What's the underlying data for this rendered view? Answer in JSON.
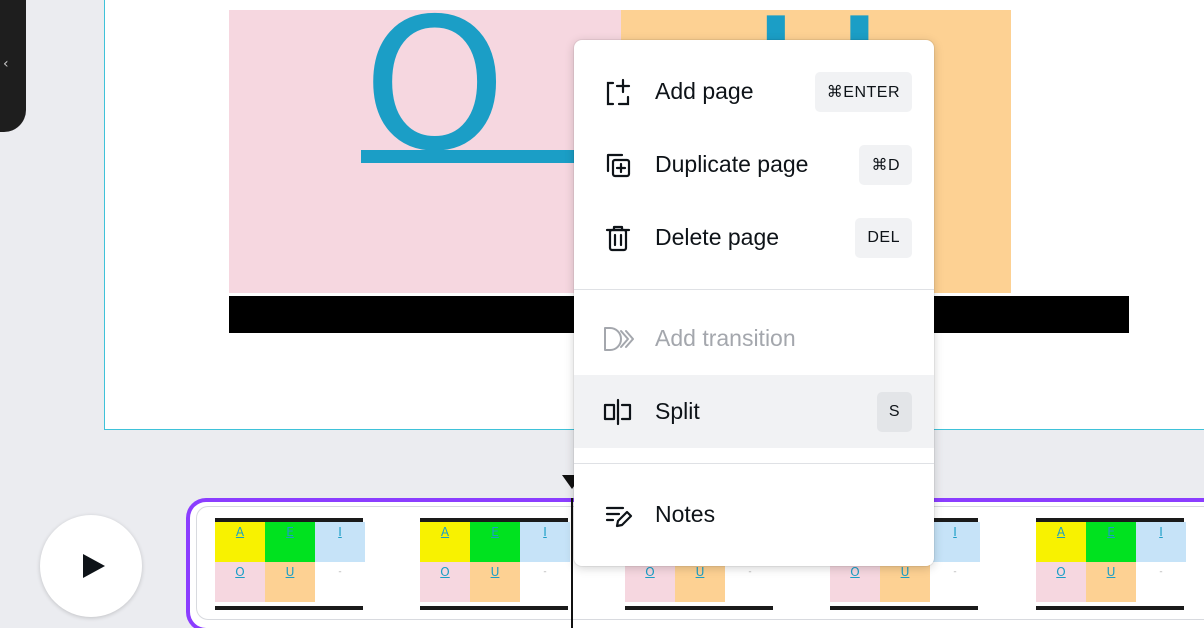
{
  "canvas": {
    "big_letters": [
      "O",
      "U"
    ]
  },
  "timeline": {
    "thumbnail_cells": [
      "A",
      "E",
      "I",
      "O",
      "U",
      "-"
    ]
  },
  "context_menu": {
    "add_page": {
      "label": "Add page",
      "shortcut": "⌘ENTER",
      "icon": "add-page-icon"
    },
    "duplicate_page": {
      "label": "Duplicate page",
      "shortcut": "⌘D",
      "icon": "duplicate-page-icon"
    },
    "delete_page": {
      "label": "Delete page",
      "shortcut": "DEL",
      "icon": "trash-icon"
    },
    "add_transition": {
      "label": "Add transition",
      "icon": "transition-icon",
      "disabled": true
    },
    "split": {
      "label": "Split",
      "shortcut": "S",
      "icon": "split-icon",
      "hovered": true
    },
    "notes": {
      "label": "Notes",
      "icon": "notes-icon"
    }
  },
  "colors": {
    "accent": "#8b3dff",
    "canvas_border": "#3ec2d9",
    "letter": "#1b9ec6",
    "pink": "#f6d7e0",
    "orange": "#fdd193",
    "yellow": "#f8f200",
    "green": "#00e21f",
    "light_blue": "#c6e3f8"
  }
}
